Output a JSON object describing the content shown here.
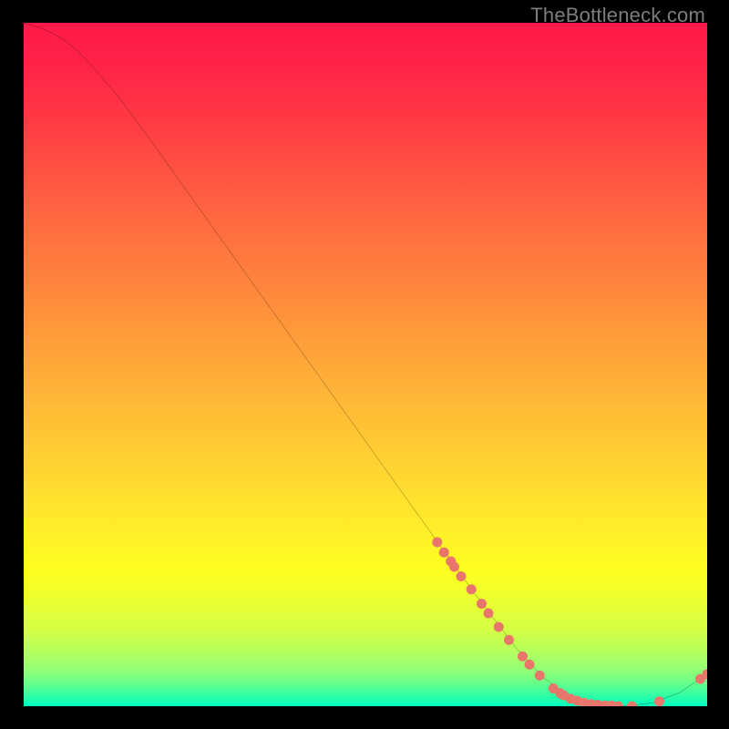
{
  "watermark": "TheBottleneck.com",
  "chart_data": {
    "type": "line",
    "title": "",
    "xlabel": "",
    "ylabel": "",
    "xlim": [
      0,
      100
    ],
    "ylim": [
      0,
      100
    ],
    "grid": false,
    "background_gradient": {
      "stops": [
        {
          "pos": 0.0,
          "color": "#ff1a49"
        },
        {
          "pos": 0.06,
          "color": "#ff2247"
        },
        {
          "pos": 0.14,
          "color": "#ff3944"
        },
        {
          "pos": 0.22,
          "color": "#ff5342"
        },
        {
          "pos": 0.3,
          "color": "#ff6c40"
        },
        {
          "pos": 0.38,
          "color": "#ff843d"
        },
        {
          "pos": 0.46,
          "color": "#ff9c3a"
        },
        {
          "pos": 0.54,
          "color": "#ffb437"
        },
        {
          "pos": 0.62,
          "color": "#ffcb33"
        },
        {
          "pos": 0.7,
          "color": "#ffe22e"
        },
        {
          "pos": 0.77,
          "color": "#fff626"
        },
        {
          "pos": 0.8,
          "color": "#feff20"
        },
        {
          "pos": 0.83,
          "color": "#f2ff2a"
        },
        {
          "pos": 0.86,
          "color": "#e4ff38"
        },
        {
          "pos": 0.89,
          "color": "#d3ff47"
        },
        {
          "pos": 0.91,
          "color": "#c0ff56"
        },
        {
          "pos": 0.93,
          "color": "#a9ff66"
        },
        {
          "pos": 0.95,
          "color": "#8cff77"
        },
        {
          "pos": 0.965,
          "color": "#6aff89"
        },
        {
          "pos": 0.978,
          "color": "#44ff9c"
        },
        {
          "pos": 0.99,
          "color": "#1effaf"
        },
        {
          "pos": 1.0,
          "color": "#00ffbf"
        }
      ]
    },
    "series": [
      {
        "name": "bottleneck-curve",
        "color": "#000000",
        "x": [
          0.0,
          2.0,
          4.0,
          6.0,
          8.0,
          10.0,
          14.0,
          18.0,
          24.0,
          30.0,
          36.0,
          42.0,
          48.0,
          54.0,
          60.0,
          66.0,
          72.0,
          76.0,
          80.0,
          84.0,
          88.0,
          92.0,
          96.0,
          100.0
        ],
        "y": [
          100.0,
          99.4,
          98.6,
          97.4,
          95.8,
          93.7,
          89.0,
          83.6,
          75.2,
          66.8,
          58.4,
          50.0,
          41.6,
          33.2,
          24.8,
          16.5,
          8.6,
          4.2,
          1.4,
          0.2,
          0.0,
          0.5,
          2.0,
          4.7
        ]
      }
    ],
    "points": {
      "name": "highlight-points",
      "color": "#e9766a",
      "radius": 5.5,
      "xy": [
        [
          60.5,
          24.0
        ],
        [
          61.5,
          22.5
        ],
        [
          62.5,
          21.2
        ],
        [
          63.0,
          20.4
        ],
        [
          64.0,
          19.0
        ],
        [
          65.5,
          17.1
        ],
        [
          67.0,
          15.0
        ],
        [
          68.0,
          13.6
        ],
        [
          69.5,
          11.6
        ],
        [
          71.0,
          9.7
        ],
        [
          73.0,
          7.3
        ],
        [
          74.0,
          6.1
        ],
        [
          75.5,
          4.5
        ],
        [
          77.5,
          2.6
        ],
        [
          78.5,
          1.9
        ],
        [
          79.0,
          1.6
        ],
        [
          80.0,
          1.1
        ],
        [
          81.0,
          0.8
        ],
        [
          82.0,
          0.5
        ],
        [
          83.0,
          0.3
        ],
        [
          84.0,
          0.2
        ],
        [
          85.0,
          0.1
        ],
        [
          86.0,
          0.1
        ],
        [
          87.0,
          0.0
        ],
        [
          89.0,
          0.0
        ],
        [
          93.0,
          0.7
        ],
        [
          99.0,
          4.0
        ],
        [
          100.0,
          4.7
        ]
      ]
    }
  }
}
